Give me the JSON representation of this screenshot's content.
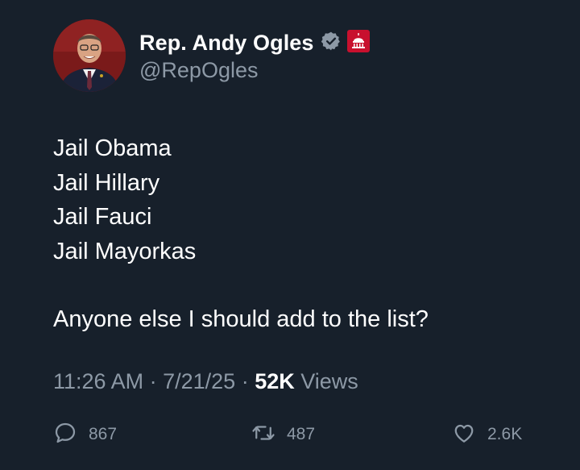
{
  "author": {
    "display_name": "Rep. Andy Ogles",
    "handle": "@RepOgles",
    "verified_icon": "verified-badge-icon",
    "affiliation_icon": "government-badge-icon"
  },
  "tweet": {
    "lines": [
      "Jail Obama",
      "Jail Hillary",
      "Jail Fauci",
      "Jail Mayorkas"
    ],
    "question": "Anyone else I should add to the list?"
  },
  "meta": {
    "time": "11:26 AM",
    "separator": "·",
    "date": "7/21/25",
    "views_count": "52K",
    "views_label": "Views"
  },
  "actions": {
    "replies": "867",
    "retweets": "487",
    "likes": "2.6K"
  },
  "colors": {
    "background": "#17202b",
    "text": "#ffffff",
    "secondary": "#8d99a6",
    "badge_red": "#c8102e"
  }
}
